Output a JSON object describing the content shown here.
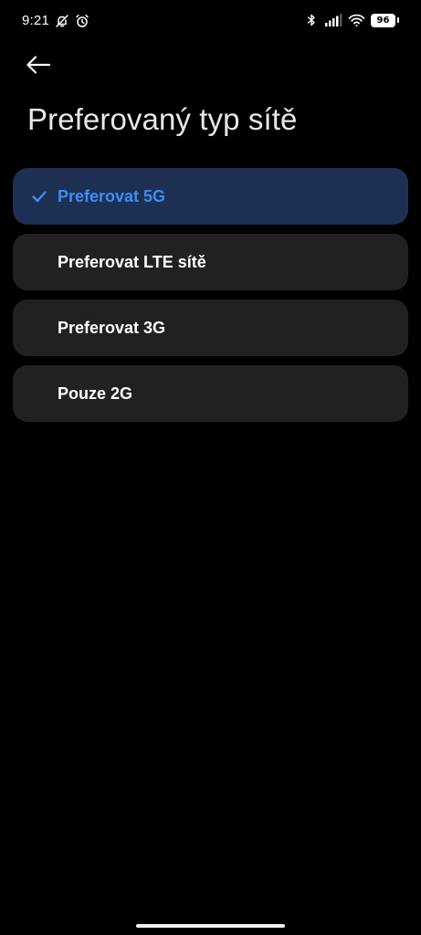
{
  "status_bar": {
    "time": "9:21",
    "battery": "96",
    "left_icons": [
      "bell-off-icon",
      "alarm-clock-icon"
    ],
    "right_icons": [
      "bluetooth-icon",
      "signal-icon",
      "wifi-icon",
      "battery-icon"
    ]
  },
  "header": {
    "back_icon": "arrow-left-icon",
    "title": "Preferovaný typ sítě"
  },
  "options": [
    {
      "label": "Preferovat 5G",
      "selected": true
    },
    {
      "label": "Preferovat LTE sítě",
      "selected": false
    },
    {
      "label": "Preferovat 3G",
      "selected": false
    },
    {
      "label": "Pouze 2G",
      "selected": false
    }
  ],
  "colors": {
    "background": "#000000",
    "option_background": "#212121",
    "selected_background": "#1d3053",
    "accent": "#3d8df5",
    "text": "#ffffff"
  }
}
